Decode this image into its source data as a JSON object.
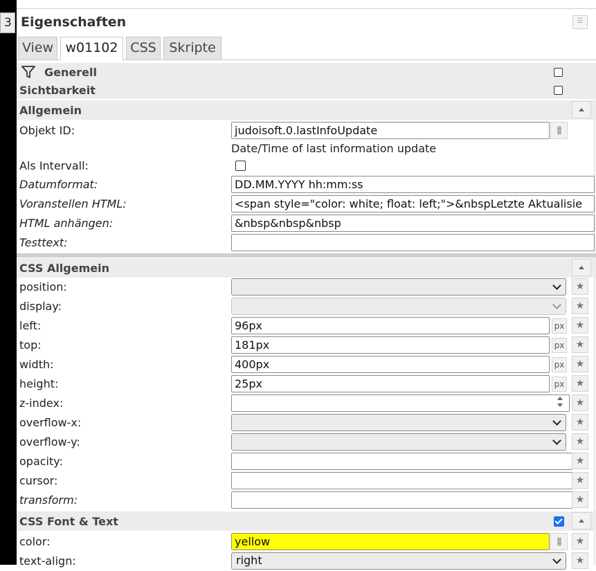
{
  "tab_marker": "3",
  "panel": {
    "title": "Eigenschaften",
    "tabs": [
      "View",
      "w01102",
      "CSS",
      "Skripte"
    ],
    "active_tab": "w01102"
  },
  "sections": {
    "generell": {
      "label": "Generell",
      "checked": false
    },
    "sichtbarkeit": {
      "label": "Sichtbarkeit",
      "checked": false
    },
    "allgemein": {
      "label": "Allgemein"
    },
    "css_allgemein": {
      "label": "CSS Allgemein"
    },
    "css_font_text": {
      "label": "CSS Font & Text",
      "checked": true
    }
  },
  "allgemein": {
    "objekt_id": {
      "label": "Objekt ID:",
      "value": "judoisoft.0.lastInfoUpdate",
      "description": "Date/Time of last information update"
    },
    "als_intervall": {
      "label": "Als Intervall:",
      "checked": false
    },
    "datumformat": {
      "label": "Datumformat:",
      "value": "DD.MM.YYYY hh:mm:ss"
    },
    "voranstellen_html": {
      "label": "Voranstellen HTML:",
      "value": "<span style=\"color: white; float: left;\">&nbspLetzte Aktualisie"
    },
    "html_anhaengen": {
      "label": "HTML anhängen:",
      "value": "&nbsp&nbsp&nbsp"
    },
    "testtext": {
      "label": "Testtext:",
      "value": ""
    }
  },
  "css_allgemein": {
    "position": {
      "label": "position:",
      "value": ""
    },
    "display": {
      "label": "display:",
      "value": ""
    },
    "left": {
      "label": "left:",
      "value": "96px",
      "unit": "px"
    },
    "top": {
      "label": "top:",
      "value": "181px",
      "unit": "px"
    },
    "width": {
      "label": "width:",
      "value": "400px",
      "unit": "px"
    },
    "height": {
      "label": "height:",
      "value": "25px",
      "unit": "px"
    },
    "z_index": {
      "label": "z-index:",
      "value": ""
    },
    "overflow_x": {
      "label": "overflow-x:",
      "value": ""
    },
    "overflow_y": {
      "label": "overflow-y:",
      "value": ""
    },
    "opacity": {
      "label": "opacity:",
      "value": ""
    },
    "cursor": {
      "label": "cursor:",
      "value": ""
    },
    "transform": {
      "label": "transform:",
      "value": ""
    }
  },
  "css_font_text": {
    "color": {
      "label": "color:",
      "value": "yellow",
      "swatch": "#ffff00"
    },
    "text_align": {
      "label": "text-align:",
      "value": "right"
    }
  },
  "icons": {
    "star": "star-icon",
    "filter": "filter-icon",
    "object_browse": "object-browse-icon"
  },
  "colors": {
    "header_bg": "#ececec",
    "checkbox_checked": "#1a73e8",
    "color_field_bg": "#ffff00"
  }
}
